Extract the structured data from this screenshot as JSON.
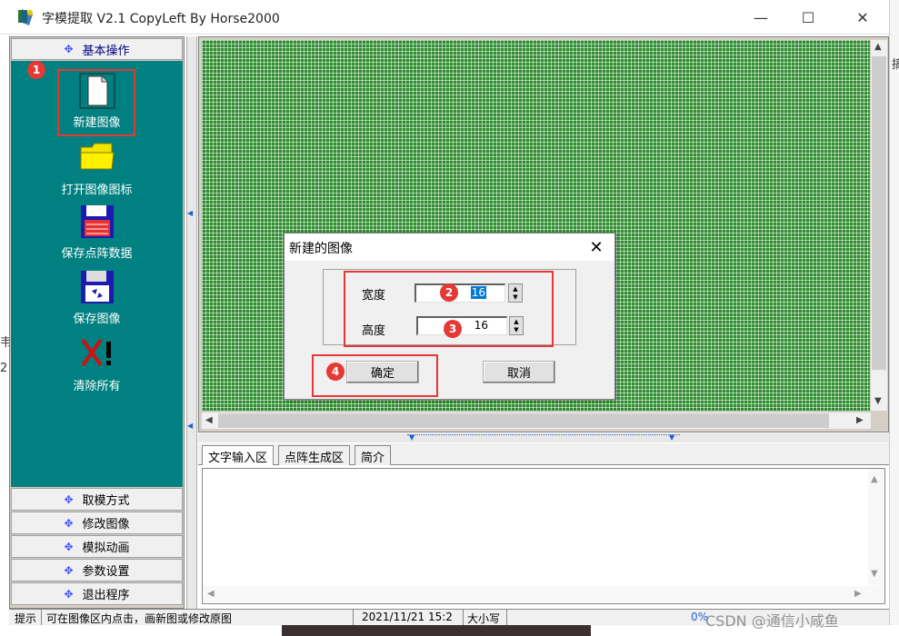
{
  "window": {
    "title": "字模提取 V2.1  CopyLeft By Horse2000",
    "minimize_glyph": "—",
    "maximize_glyph": "☐",
    "close_glyph": "✕"
  },
  "left_panel": {
    "section_header": "基本操作",
    "tools": [
      {
        "label": "新建图像",
        "icon": "new-image-icon"
      },
      {
        "label": "打开图像图标",
        "icon": "open-folder-icon"
      },
      {
        "label": "保存点阵数据",
        "icon": "save-data-disk-icon"
      },
      {
        "label": "保存图像",
        "icon": "save-image-disk-icon"
      },
      {
        "label": "清除所有",
        "icon": "clear-all-icon"
      }
    ],
    "bottom_menu": [
      "取模方式",
      "修改图像",
      "模拟动画",
      "参数设置",
      "退出程序"
    ]
  },
  "tabs": [
    "文字输入区",
    "点阵生成区",
    "简介"
  ],
  "status_bar": {
    "hint_label": "提示",
    "hint_text": "可在图像区内点击，画新图或修改原图",
    "datetime": "2021/11/21  15:2",
    "caps": "大小写",
    "percent": "0%"
  },
  "dialog": {
    "title": "新建的图像",
    "width_label": "宽度",
    "width_value": "16",
    "height_label": "高度",
    "height_value": "16",
    "ok_label": "确定",
    "cancel_label": "取消"
  },
  "annotations": [
    "1",
    "2",
    "3",
    "4"
  ],
  "outside": {
    "right_char": "搞",
    "left_char_a": "韦",
    "left_char_b": "2",
    "watermark": "CSDN @通信小咸鱼"
  },
  "colors": {
    "teal": "#008080",
    "grid_green": "#2e8b2e",
    "annotation_red": "#e53935",
    "accent_blue": "#3f51ff"
  }
}
